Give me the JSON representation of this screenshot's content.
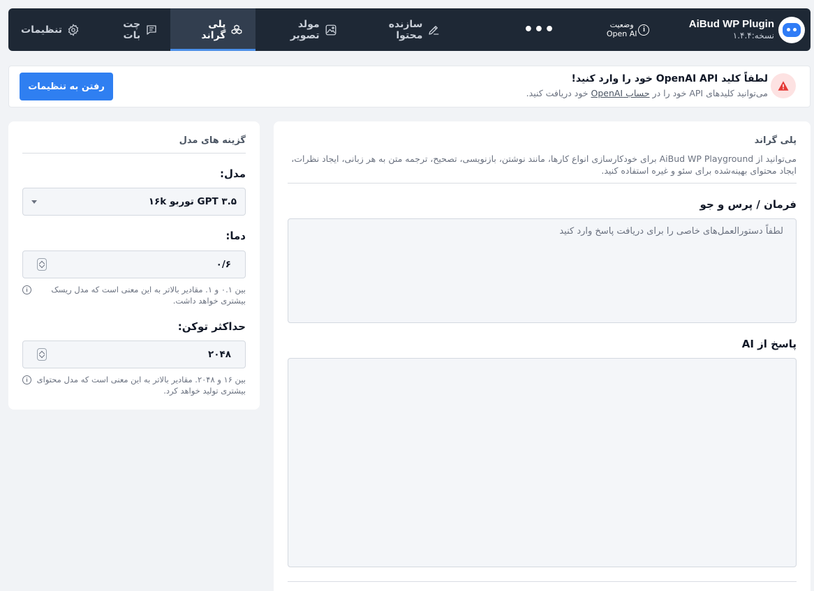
{
  "brand": {
    "name": "AiBud WP Plugin",
    "version": "نسخه:۱.۴.۴"
  },
  "status": {
    "label": "وضعیت",
    "value": "Open AI"
  },
  "nav": {
    "more": "•••",
    "tabs": [
      {
        "label": "سازنده محتوا",
        "icon": "pen-icon"
      },
      {
        "label": "مولد تصویر",
        "icon": "image-icon"
      },
      {
        "label": "پلی گراند",
        "icon": "cubes-icon",
        "active": true
      },
      {
        "label": "چت بات",
        "icon": "chat-icon"
      },
      {
        "label": "تنظیمات",
        "icon": "gear-icon"
      }
    ]
  },
  "alert": {
    "title": "لطفاً کلید OpenAI API خود را وارد کنید!",
    "body_prefix": "می‌توانید کلیدهای API خود را در ",
    "body_link": "حساب OpenAI",
    "body_suffix": " خود دریافت کنید.",
    "button": "رفتن به تنظیمات",
    "icon": "warning-icon",
    "color": "#e53935"
  },
  "playground": {
    "title": "پلی گراند",
    "description": "می‌توانید از AiBud WP Playground برای خودکارسازی انواع کارها، مانند نوشتن، بازنویسی، تصحیح، ترجمه متن به هر زبانی، ایجاد نظرات، ایجاد محتوای بهینه‌شده برای سئو و غیره استفاده کنید.",
    "prompt_label": "فرمان / پرس و جو",
    "prompt_placeholder": "لطفاً دستورالعمل‌های خاصی را برای دریافت پاسخ وارد کنید",
    "prompt_value": "",
    "response_label": "پاسخ از AI",
    "response_value": ""
  },
  "model_options": {
    "title": "گزینه های مدل",
    "model_label": "مدل:",
    "model_value": "GPT ۳.۵ توربو ۱۶k",
    "temperature_label": "دما:",
    "temperature_value": "۰/۶",
    "temperature_hint": "بین ۰.۱ و ۱. مقادیر بالاتر به این معنی است که مدل ریسک بیشتری خواهد داشت.",
    "max_tokens_label": "حداکثر توکن:",
    "max_tokens_value": "۲۰۴۸",
    "max_tokens_hint": "بین ۱۶ و ۲۰۴۸. مقادیر بالاتر به این معنی است که مدل محتوای بیشتری تولید خواهد کرد."
  },
  "colors": {
    "nav_bg": "#1e2835",
    "accent": "#2f7ff1",
    "page_bg": "#f1f3f6"
  }
}
